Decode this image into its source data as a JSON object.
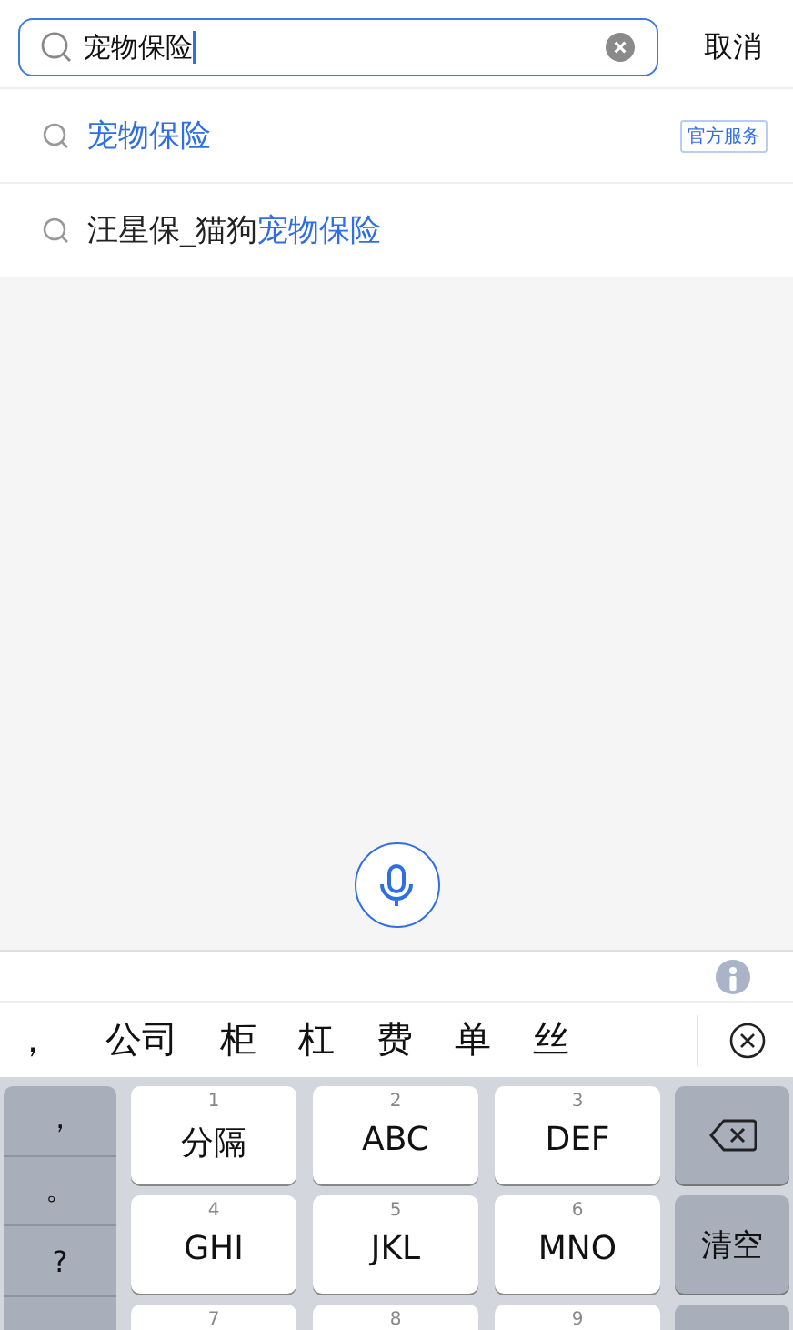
{
  "search": {
    "value": "宠物保险",
    "cancel": "取消"
  },
  "suggestions": [
    {
      "parts": [
        {
          "text": "宠物保险",
          "highlight": true
        }
      ],
      "badge": "官方服务"
    },
    {
      "parts": [
        {
          "text": "汪星保_猫狗",
          "highlight": false
        },
        {
          "text": "宠物保险",
          "highlight": true
        }
      ]
    }
  ],
  "candidates": [
    "，",
    "公司",
    "柜",
    "杠",
    "费",
    "单",
    "丝"
  ],
  "keyboard": {
    "symbols": [
      "，",
      "。",
      "?"
    ],
    "keys": [
      {
        "number": "1",
        "letters": "分隔"
      },
      {
        "number": "2",
        "letters": "ABC"
      },
      {
        "number": "3",
        "letters": "DEF"
      },
      {
        "number": "4",
        "letters": "GHI"
      },
      {
        "number": "5",
        "letters": "JKL"
      },
      {
        "number": "6",
        "letters": "MNO"
      },
      {
        "number": "7"
      },
      {
        "number": "8"
      },
      {
        "number": "9"
      }
    ],
    "clear": "清空"
  }
}
